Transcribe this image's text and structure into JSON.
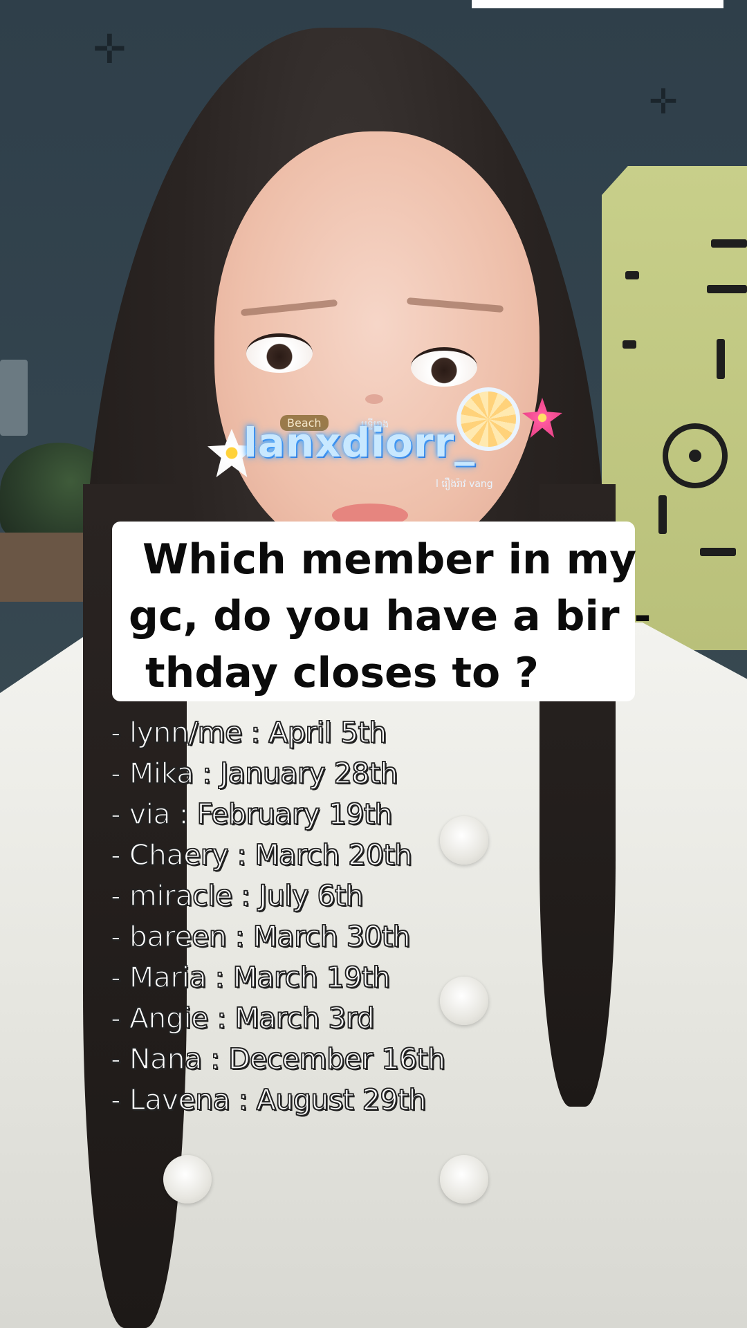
{
  "question": {
    "lines": [
      "Which member in my",
      "gc, do you have a bir -",
      "thday closes to ?"
    ]
  },
  "birthdays": [
    "- lynn/me : April 5th",
    "- Mika : January 28th",
    "- via : February 19th",
    "- Chaery : March 20th",
    "- miracle : July 6th",
    "- bareen : March 30th",
    "- Maria : March 19th",
    "- Angie : March 3rd",
    "- Nana : December 16th",
    "- Lavena : August 29th"
  ],
  "watermark": {
    "username": "lanxdiorr_",
    "badge": "Beach",
    "small_top": "បុទ្ទីរោង",
    "small_bottom": "l រឿងរ៉ាវ vang"
  },
  "icons": {
    "sparkle": "four-point-star",
    "watermark_decor": [
      "orange-slice-icon",
      "hibiscus-icon",
      "plumeria-icon"
    ]
  },
  "colors": {
    "card_background": "#ffffff",
    "question_text": "#0b0b0b",
    "list_text": "#ffffff",
    "list_outline": "#222222",
    "watermark_glow": "#4aa8ff"
  }
}
